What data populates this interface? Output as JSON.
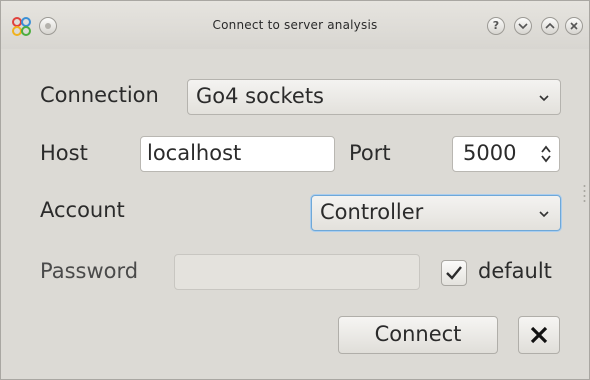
{
  "window": {
    "title": "Connect to server analysis"
  },
  "form": {
    "connection": {
      "label": "Connection",
      "value": "Go4 sockets"
    },
    "host": {
      "label": "Host",
      "value": "localhost"
    },
    "port": {
      "label": "Port",
      "value": "5000"
    },
    "account": {
      "label": "Account",
      "value": "Controller"
    },
    "password": {
      "label": "Password",
      "value": ""
    },
    "default_checkbox": {
      "label": "default",
      "checked": true
    }
  },
  "buttons": {
    "connect_label": "Connect",
    "cancel_glyph": "✕"
  },
  "icons": {
    "app": "go4-app-icon",
    "menu": "window-menu-icon",
    "help": "help-icon",
    "minimize": "minimize-icon",
    "maximize": "maximize-icon",
    "close": "close-icon"
  },
  "colors": {
    "window_bg": "#dcdad5",
    "focus_border": "#6fa8d8",
    "field_bg": "#ffffff"
  }
}
